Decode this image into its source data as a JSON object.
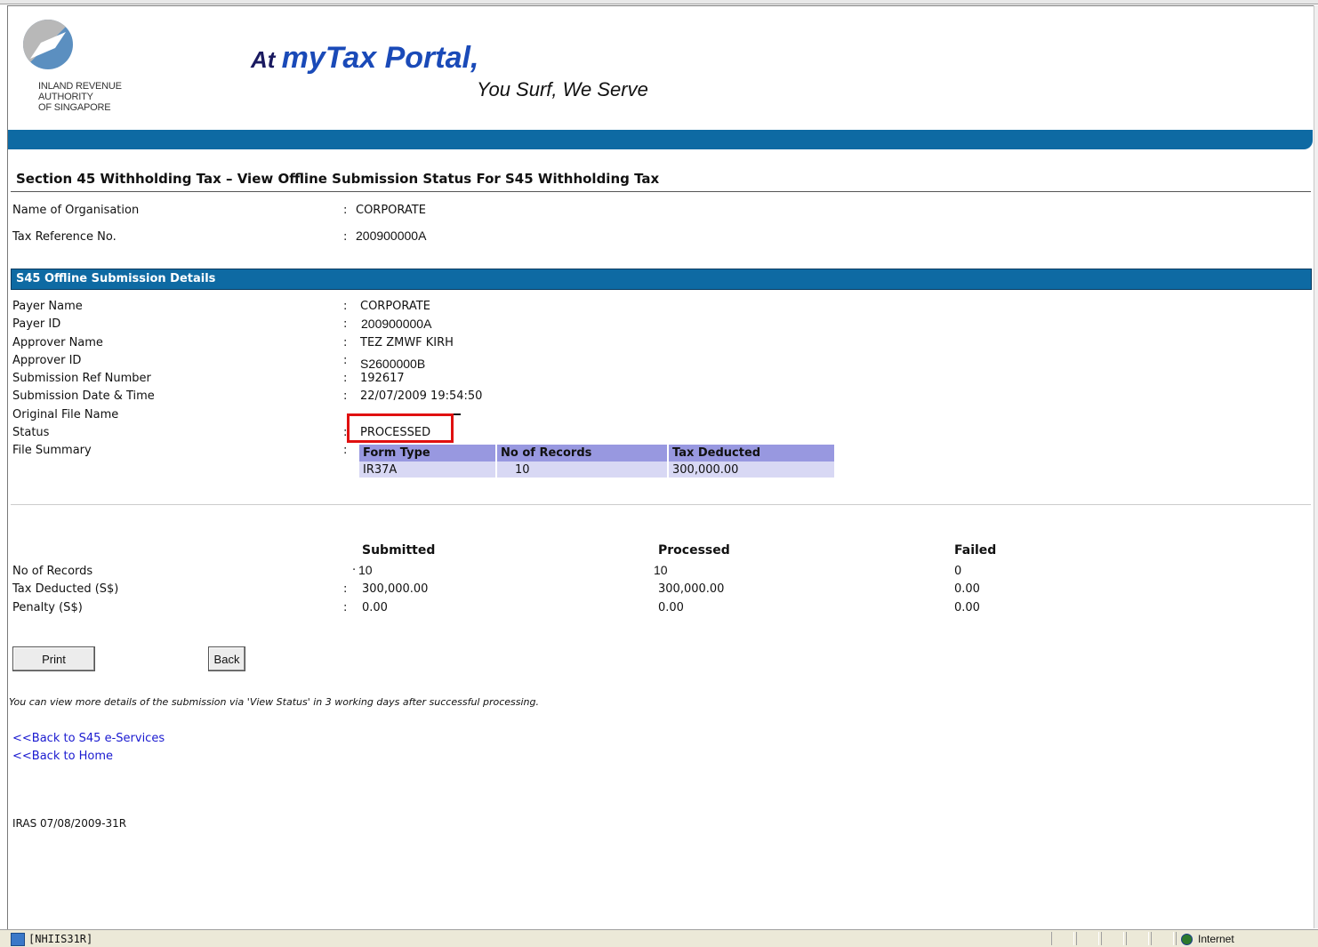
{
  "header": {
    "org_line1": "INLAND REVENUE",
    "org_line2": "AUTHORITY",
    "org_line3": "OF SINGAPORE",
    "tagline_at": "At ",
    "tagline_portal": "myTax Portal,",
    "slogan": "You Surf, We Serve"
  },
  "page_title": "Section 45 Withholding Tax – View Offline Submission Status For S45 Withholding Tax",
  "organisation": {
    "name_label": "Name of Organisation",
    "name_value": "CORPORATE",
    "taxref_label": "Tax Reference No.",
    "taxref_value": "200900000A"
  },
  "section_title": "S45 Offline Submission Details",
  "details": {
    "payer_name_label": "Payer Name",
    "payer_name_value": "CORPORATE",
    "payer_id_label": "Payer ID",
    "payer_id_value": "200900000A",
    "approver_name_label": "Approver Name",
    "approver_name_value": "TEZ ZMWF KIRH",
    "approver_id_label": "Approver ID",
    "approver_id_value": "S2600000B",
    "subref_label": "Submission Ref Number",
    "subref_value": "192617",
    "subdate_label": "Submission Date & Time",
    "subdate_value": "22/07/2009 19:54:50",
    "filename_label": "Original File Name",
    "status_label": "Status",
    "status_value": "PROCESSED",
    "filesummary_label": "File Summary"
  },
  "file_summary": {
    "headers": [
      "Form Type",
      "No of Records",
      "Tax Deducted"
    ],
    "row": [
      "IR37A",
      "10",
      "300,000.00"
    ]
  },
  "totals": {
    "col_submitted": "Submitted",
    "col_processed": "Processed",
    "col_failed": "Failed",
    "records_label": "No of Records",
    "records": [
      "10",
      "10",
      "0"
    ],
    "tax_label": "Tax Deducted (S$)",
    "tax": [
      "300,000.00",
      "300,000.00",
      "0.00"
    ],
    "penalty_label": "Penalty (S$)",
    "penalty": [
      "0.00",
      "0.00",
      "0.00"
    ]
  },
  "buttons": {
    "print": "Print",
    "back": "Back"
  },
  "note": "You can view more details of the submission via 'View Status' in 3 working days after successful processing.",
  "links": {
    "s45": "<<Back to S45 e-Services",
    "home": "<<Back to Home"
  },
  "footer_code": "IRAS 07/08/2009-31R",
  "statusbar": {
    "server": "[NHIIS31R]",
    "zone": "Internet"
  },
  "colors": {
    "band": "#0e6aa3",
    "table_header": "#9898e0",
    "table_row": "#d8d8f4",
    "highlight": "#e01010",
    "link": "#1a1ad0"
  }
}
